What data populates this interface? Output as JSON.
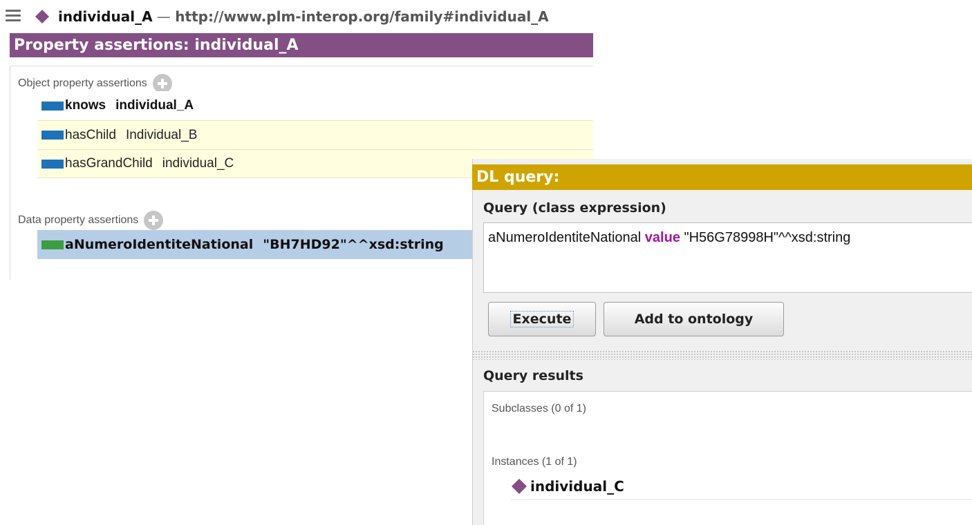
{
  "colors": {
    "individual_diamond": "#834f85",
    "property_assertions_header": "#834f85",
    "dl_query_header": "#cfa400",
    "object_property_chip": "#1d72b8",
    "data_property_chip": "#3b9e42",
    "query_keyword": "#a0169c",
    "selected_row": "#b6cde6",
    "inferred_row": "#ffffe0"
  },
  "entity_bar": {
    "menu_icon": "hamburger-icon",
    "entity_icon": "individual-diamond-icon",
    "name": "individual_A",
    "separator": "—",
    "iri": "http://www.plm-interop.org/family#individual_A"
  },
  "property_assertions": {
    "title": "Property assertions: individual_A",
    "object_section": {
      "label": "Object property assertions",
      "add_icon": "plus-circle-icon",
      "items": [
        {
          "property": "knows",
          "value": "individual_A"
        },
        {
          "property": "hasChild",
          "value": "Individual_B"
        },
        {
          "property": "hasGrandChild",
          "value": "individual_C"
        }
      ]
    },
    "data_section": {
      "label": "Data property assertions",
      "add_icon": "plus-circle-icon",
      "items": [
        {
          "property": "aNumeroIdentiteNational",
          "value": "\"BH7HD92\"^^xsd:string"
        }
      ]
    }
  },
  "dl_query": {
    "title": "DL query:",
    "query_label": "Query (class expression)",
    "query": {
      "before": "aNumeroIdentiteNational ",
      "keyword": "value",
      "after": " \"H56G78998H\"^^xsd:string"
    },
    "execute_label": "Execute",
    "add_label": "Add to ontology",
    "results_label": "Query results",
    "subclasses_label": "Subclasses (0 of 1)",
    "instances_label": "Instances (1 of 1)",
    "instances": [
      {
        "name": "individual_C",
        "icon": "individual-diamond-icon"
      }
    ]
  }
}
